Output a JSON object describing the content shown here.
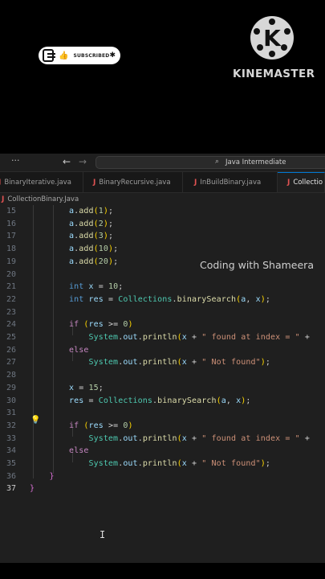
{
  "overlay": {
    "subscribe_label": "SUBSCRIBED",
    "kinemaster_label": "KINEMASTER",
    "kinemaster_letter": "K",
    "watermark": "Coding with Shameera"
  },
  "titlebar": {
    "menu_dots": "···",
    "back_arrow": "←",
    "forward_arrow": "→",
    "search_text": "Java Intermediate",
    "search_icon": "search-icon"
  },
  "tabs": [
    {
      "icon": "J",
      "label": "BinaryIterative.java"
    },
    {
      "icon": "J",
      "label": "BinaryRecursive.java"
    },
    {
      "icon": "J",
      "label": "InBuildBinary.java"
    },
    {
      "icon": "J",
      "label": "Collectio",
      "active": true
    }
  ],
  "breadcrumb": {
    "icon": "J",
    "label": "CollectionBinary.Java"
  },
  "code_lines": [
    {
      "n": "15",
      "html": "        a.add(1);"
    },
    {
      "n": "16",
      "html": "        a.add(2);"
    },
    {
      "n": "17",
      "html": "        a.add(3);"
    },
    {
      "n": "18",
      "html": "        a.add(10);"
    },
    {
      "n": "19",
      "html": "        a.add(20);"
    },
    {
      "n": "20",
      "html": ""
    },
    {
      "n": "21",
      "html": "        int x = 10;"
    },
    {
      "n": "22",
      "html": "        int res = Collections.binarySearch(a, x);"
    },
    {
      "n": "23",
      "html": ""
    },
    {
      "n": "24",
      "html": "        if (res >= 0)"
    },
    {
      "n": "25",
      "html": "            System.out.println(x + \" found at index = \" +"
    },
    {
      "n": "26",
      "html": "        else"
    },
    {
      "n": "27",
      "html": "            System.out.println(x + \" Not found\");"
    },
    {
      "n": "28",
      "html": ""
    },
    {
      "n": "29",
      "html": "        x = 15;"
    },
    {
      "n": "30",
      "html": "        res = Collections.binarySearch(a, x);"
    },
    {
      "n": "31",
      "html": ""
    },
    {
      "n": "32",
      "html": "        if (res >= 0)"
    },
    {
      "n": "33",
      "html": "            System.out.println(x + \" found at index = \" +"
    },
    {
      "n": "34",
      "html": "        else"
    },
    {
      "n": "35",
      "html": "            System.out.println(x + \" Not found\");"
    },
    {
      "n": "36",
      "html": "    }"
    },
    {
      "n": "37",
      "html": "}"
    }
  ],
  "colors": {
    "keyword": "#569cd6",
    "string": "#ce9178",
    "number": "#b5cea8",
    "class": "#4ec9b0",
    "function": "#dcdcaa"
  }
}
